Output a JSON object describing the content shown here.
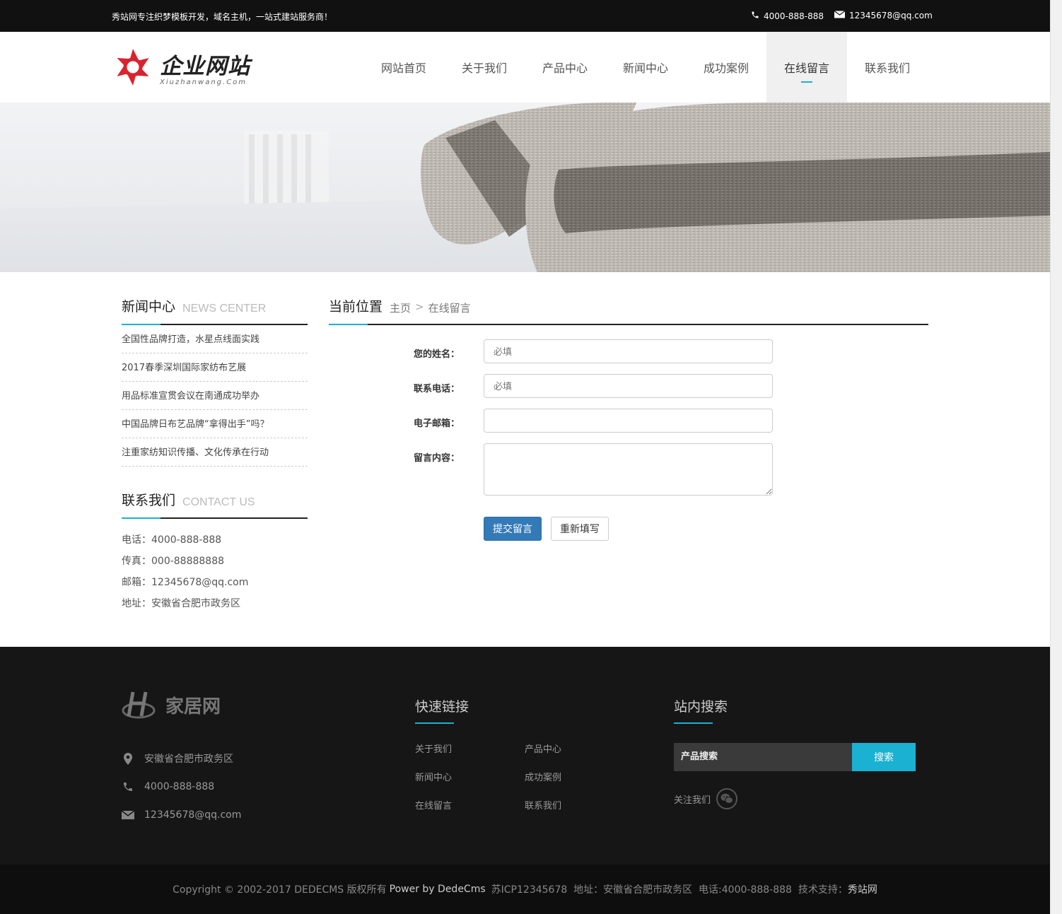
{
  "topbar": {
    "slogan": "秀站网专注织梦模板开发，域名主机，一站式建站服务商！",
    "phone": "4000-888-888",
    "email": "12345678@qq.com"
  },
  "logo": {
    "title": "企业网站",
    "subtitle": "Xiuzhanwang.Com"
  },
  "nav": {
    "items": [
      {
        "label": "网站首页"
      },
      {
        "label": "关于我们"
      },
      {
        "label": "产品中心"
      },
      {
        "label": "新闻中心"
      },
      {
        "label": "成功案例"
      },
      {
        "label": "在线留言"
      },
      {
        "label": "联系我们"
      }
    ],
    "active": "在线留言"
  },
  "sidebar": {
    "news": {
      "title_cn": "新闻中心",
      "title_en": "NEWS CENTER",
      "items": [
        "全国性品牌打造，水星点线面实践",
        "2017春季深圳国际家纺布艺展",
        "用品标准宣贯会议在南通成功举办",
        "中国品牌日布艺品牌“拿得出手”吗？",
        "注重家纺知识传播、文化传承在行动"
      ]
    },
    "contact": {
      "title_cn": "联系我们",
      "title_en": "CONTACT US",
      "lines": [
        "电话：4000-888-888",
        "传真：000-88888888",
        "邮箱：12345678@qq.com",
        "地址：安徽省合肥市政务区"
      ]
    }
  },
  "content": {
    "title": "当前位置",
    "breadcrumb": {
      "home": "主页",
      "sep": ">",
      "current": "在线留言"
    },
    "form": {
      "name_label": "您的姓名：",
      "name_placeholder": "必填",
      "phone_label": "联系电话：",
      "phone_placeholder": "必填",
      "email_label": "电子邮箱：",
      "message_label": "留言内容：",
      "submit": "提交留言",
      "reset": "重新填写"
    }
  },
  "footer": {
    "brand": "家居网",
    "address": "安徽省合肥市政务区",
    "phone": "4000-888-888",
    "email": "12345678@qq.com",
    "quicklinks_title": "快速链接",
    "quicklinks": [
      "关于我们",
      "产品中心",
      "新闻中心",
      "成功案例",
      "在线留言",
      "联系我们"
    ],
    "search_title": "站内搜索",
    "search_value": "产品搜索",
    "search_button": "搜索",
    "follow": "关注我们"
  },
  "copyright": {
    "text1": "Copyright © 2002-2017 DEDECMS 版权所有",
    "power": "Power by DedeCms",
    "text2": "苏ICP12345678  地址：安徽省合肥市政务区  电话:4000-888-888  技术支持：",
    "support": "秀站网"
  },
  "colors": {
    "accent": "#1ab1d2",
    "primary_button": "#337ab7",
    "topbar": "#111111",
    "footer": "#161616"
  }
}
